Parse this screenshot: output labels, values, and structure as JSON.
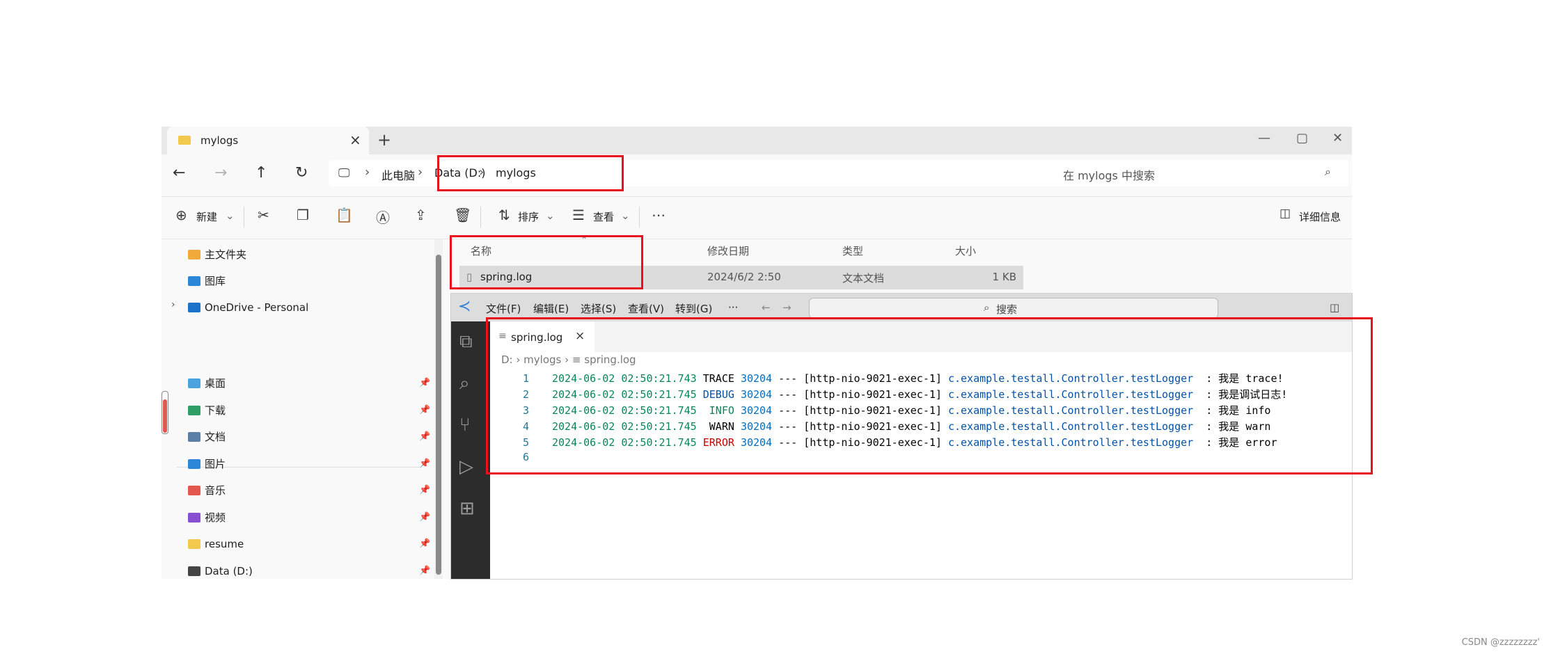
{
  "explorer": {
    "tab_title": "mylogs",
    "window_controls": [
      "—",
      "▢",
      "✕"
    ],
    "address": {
      "items": [
        "此电脑",
        "Data (D:)",
        "mylogs"
      ]
    },
    "search_placeholder": "在 mylogs 中搜索",
    "toolbar": {
      "new_label": "新建",
      "sort_label": "排序",
      "view_label": "查看",
      "details_label": "详细信息"
    },
    "sidebar": {
      "top": [
        {
          "label": "主文件夹",
          "icon": "home-icon",
          "color": "#f2a93b"
        },
        {
          "label": "图库",
          "icon": "gallery-icon",
          "color": "#2b88d8"
        },
        {
          "label": "OneDrive - Personal",
          "icon": "onedrive-icon",
          "color": "#1a73c8"
        }
      ],
      "pinned": [
        {
          "label": "桌面",
          "icon": "desktop-icon",
          "color": "#4aa3df"
        },
        {
          "label": "下载",
          "icon": "download-icon",
          "color": "#2f9e67"
        },
        {
          "label": "文档",
          "icon": "documents-icon",
          "color": "#5b7fa6"
        },
        {
          "label": "图片",
          "icon": "pictures-icon",
          "color": "#2b88d8"
        },
        {
          "label": "音乐",
          "icon": "music-icon",
          "color": "#e4574c"
        },
        {
          "label": "视频",
          "icon": "videos-icon",
          "color": "#8a4fd1"
        },
        {
          "label": "resume",
          "icon": "folder-icon",
          "color": "#f2c94c"
        },
        {
          "label": "Data (D:)",
          "icon": "drive-icon",
          "color": "#444444"
        }
      ]
    },
    "columns": [
      "名称",
      "修改日期",
      "类型",
      "大小"
    ],
    "files": [
      {
        "name": "spring.log",
        "modified": "2024/6/2 2:50",
        "type": "文本文档",
        "size": "1 KB"
      }
    ]
  },
  "vscode": {
    "menu": [
      "文件(F)",
      "编辑(E)",
      "选择(S)",
      "查看(V)",
      "转到(G)",
      "···"
    ],
    "command_center": "搜索",
    "tab": {
      "label": "spring.log"
    },
    "breadcrumb": [
      "D:",
      "mylogs",
      "spring.log"
    ],
    "lines": [
      {
        "n": "1",
        "date": "2024-06-02 02:50:21.743",
        "level": " TRACE",
        "level_class": "c-trace",
        "pid": "30204",
        "thread": "[http-nio-9021-exec-1]",
        "logger": "c.example.testall.Controller.testLogger",
        "msg": "  : 我是 trace!"
      },
      {
        "n": "2",
        "date": "2024-06-02 02:50:21.745",
        "level": " DEBUG",
        "level_class": "c-debug",
        "pid": "30204",
        "thread": "[http-nio-9021-exec-1]",
        "logger": "c.example.testall.Controller.testLogger",
        "msg": "  : 我是调试日志!"
      },
      {
        "n": "3",
        "date": "2024-06-02 02:50:21.745",
        "level": "  INFO",
        "level_class": "c-info",
        "pid": "30204",
        "thread": "[http-nio-9021-exec-1]",
        "logger": "c.example.testall.Controller.testLogger",
        "msg": "  : 我是 info"
      },
      {
        "n": "4",
        "date": "2024-06-02 02:50:21.745",
        "level": "  WARN",
        "level_class": "c-warn",
        "pid": "30204",
        "thread": "[http-nio-9021-exec-1]",
        "logger": "c.example.testall.Controller.testLogger",
        "msg": "  : 我是 warn"
      },
      {
        "n": "5",
        "date": "2024-06-02 02:50:21.745",
        "level": " ERROR",
        "level_class": "c-error",
        "pid": "30204",
        "thread": "[http-nio-9021-exec-1]",
        "logger": "c.example.testall.Controller.testLogger",
        "msg": "  : 我是 error"
      },
      {
        "n": "6",
        "date": "",
        "level": "",
        "level_class": "",
        "pid": "",
        "thread": "",
        "logger": "",
        "msg": ""
      }
    ]
  },
  "watermark": "CSDN @zzzzzzzz'"
}
